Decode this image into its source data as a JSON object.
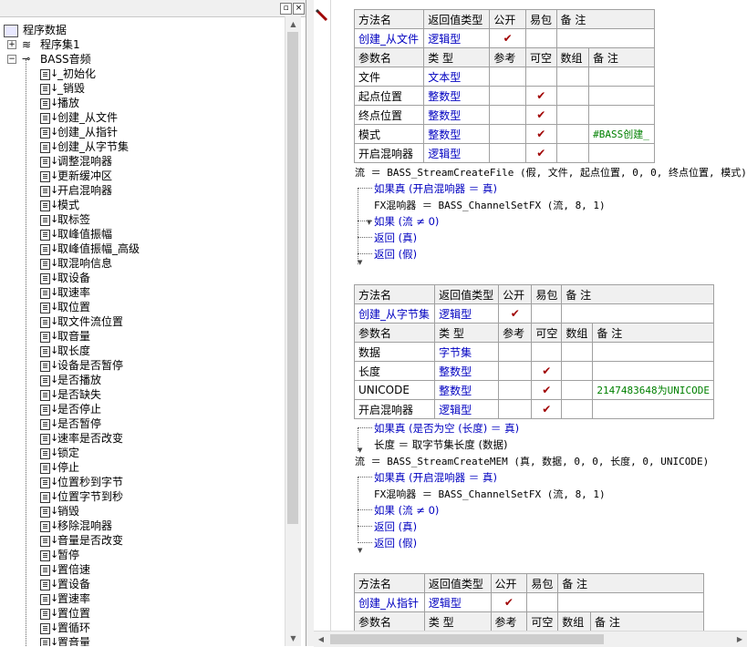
{
  "tree": {
    "root": "程序数据",
    "assembly": "程序集1",
    "module": "BASS音频",
    "items": [
      "_初始化",
      "_销毁",
      "播放",
      "创建_从文件",
      "创建_从指针",
      "创建_从字节集",
      "调整混响器",
      "更新缓冲区",
      "开启混响器",
      "模式",
      "取标签",
      "取峰值振幅",
      "取峰值振幅_高级",
      "取混响信息",
      "取设备",
      "取速率",
      "取位置",
      "取文件流位置",
      "取音量",
      "取长度",
      "设备是否暂停",
      "是否播放",
      "是否缺失",
      "是否停止",
      "是否暂停",
      "速率是否改变",
      "锁定",
      "停止",
      "位置秒到字节",
      "位置字节到秒",
      "销毁",
      "移除混响器",
      "音量是否改变",
      "暂停",
      "置倍速",
      "置设备",
      "置速率",
      "置位置",
      "置循环",
      "置音量"
    ]
  },
  "titlebar": {
    "pin": "▫",
    "close": "×"
  },
  "headers": {
    "method": [
      "方法名",
      "返回值类型",
      "公开",
      "易包",
      "备 注"
    ],
    "param": [
      "参数名",
      "类 型",
      "参考",
      "可空",
      "数组",
      "备 注"
    ]
  },
  "check": "✔",
  "m1": {
    "name": "创建_从文件",
    "ret": "逻辑型",
    "pub": "✔",
    "params": [
      {
        "n": "文件",
        "t": "文本型",
        "opt": "",
        "note": ""
      },
      {
        "n": "起点位置",
        "t": "整数型",
        "opt": "✔",
        "note": ""
      },
      {
        "n": "终点位置",
        "t": "整数型",
        "opt": "✔",
        "note": ""
      },
      {
        "n": "模式",
        "t": "整数型",
        "opt": "✔",
        "note": "#BASS创建_"
      },
      {
        "n": "开启混响器",
        "t": "逻辑型",
        "opt": "✔",
        "note": ""
      }
    ],
    "code": [
      "流 ＝ BASS_StreamCreateFile (假, 文件, 起点位置, 0, 0, 终点位置, 模式)",
      "如果真 (开启混响器 ＝ 真)",
      "FX混响器 ＝ BASS_ChannelSetFX (流, 8, 1)",
      "如果 (流 ≠ 0)",
      "返回 (真)",
      "返回 (假)"
    ]
  },
  "m2": {
    "name": "创建_从字节集",
    "ret": "逻辑型",
    "pub": "✔",
    "params": [
      {
        "n": "数据",
        "t": "字节集",
        "opt": "",
        "note": ""
      },
      {
        "n": "长度",
        "t": "整数型",
        "opt": "✔",
        "note": ""
      },
      {
        "n": "UNICODE",
        "t": "整数型",
        "opt": "✔",
        "note": "2147483648为UNICODE"
      },
      {
        "n": "开启混响器",
        "t": "逻辑型",
        "opt": "✔",
        "note": ""
      }
    ],
    "code": [
      "如果真 (是否为空 (长度) ＝ 真)",
      "长度 ＝ 取字节集长度 (数据)",
      "流 ＝ BASS_StreamCreateMEM (真, 数据, 0, 0, 长度, 0, UNICODE)",
      "如果真 (开启混响器 ＝ 真)",
      "FX混响器 ＝ BASS_ChannelSetFX (流, 8, 1)",
      "如果 (流 ≠ 0)",
      "返回 (真)",
      "返回 (假)"
    ]
  },
  "m3": {
    "name": "创建_从指针",
    "ret": "逻辑型",
    "pub": "✔"
  }
}
